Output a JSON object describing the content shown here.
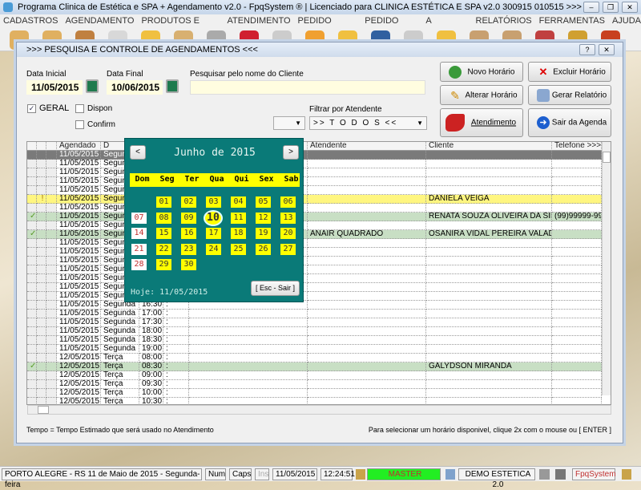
{
  "window": {
    "title": "Programa Clinica de Estética e SPA + Agendamento v2.0 - FpqSystem ® | Licenciado para  CLINICA ESTÉTICA E SPA v2.0 300915 010515 >>>"
  },
  "menu": [
    "CADASTROS",
    "AGENDAMENTO",
    "PRODUTOS E SERVIÇOS",
    "ATENDIMENTO",
    "PEDIDO COMPRAS",
    "PEDIDO VENDAS",
    "A RECEBER",
    "RELATÓRIOS",
    "FERRAMENTAS",
    "AJUDA"
  ],
  "dialog": {
    "title": ">>>  PESQUISA E CONTROLE DE AGENDAMENTOS  <<<",
    "help": "?",
    "close": "✕"
  },
  "filters": {
    "data_inicial_label": "Data Inicial",
    "data_inicial": "11/05/2015",
    "data_final_label": "Data Final",
    "data_final": "10/06/2015",
    "search_label": "Pesquisar pelo nome do Cliente",
    "search_value": "",
    "geral": "GERAL",
    "disponivel": "Dispon",
    "confirmado": "Confirm",
    "atendente_label": "Filtrar por Atendente",
    "atendente_value": ">> T O D O S <<"
  },
  "buttons": {
    "novo": "Novo Horário",
    "excluir": "Excluir Horário",
    "alterar": "Alterar Horário",
    "relatorio": "Gerar Relatório",
    "atendimento": "Atendimento",
    "sair": "Sair da Agenda"
  },
  "grid": {
    "headers": [
      "",
      "",
      "",
      "Agendado",
      "D",
      "",
      "",
      "",
      "Atendente",
      "Cliente",
      "Telefone  >>>"
    ],
    "rows": [
      [
        "",
        "",
        "",
        "11/05/2015",
        "Segunda",
        "08:00",
        ":",
        "",
        "",
        "",
        ""
      ],
      [
        "",
        "",
        "",
        "11/05/2015",
        "Segunda",
        "08:30",
        ":",
        "",
        "",
        "",
        ""
      ],
      [
        "",
        "",
        "",
        "11/05/2015",
        "Segunda",
        "09:00",
        ":",
        "",
        "",
        "",
        ""
      ],
      [
        "",
        "",
        "",
        "11/05/2015",
        "Segunda",
        "09:30",
        ":",
        "",
        "",
        "",
        ""
      ],
      [
        "",
        "",
        "",
        "11/05/2015",
        "Segunda",
        "10:00",
        ":",
        "",
        "",
        "",
        ""
      ],
      [
        "",
        "!",
        "",
        "11/05/2015",
        "Segunda",
        "10:30",
        ":",
        "",
        "",
        "DANIELA VEIGA",
        ""
      ],
      [
        "",
        "",
        "",
        "11/05/2015",
        "Segunda",
        "11:00",
        ":",
        "",
        "",
        "",
        ""
      ],
      [
        "✓",
        "",
        "",
        "11/05/2015",
        "Segunda",
        "11:30",
        ":",
        "",
        "",
        "RENATA SOUZA OLIVEIRA DA SILVA",
        "(99)99999-9999"
      ],
      [
        "",
        "",
        "",
        "11/05/2015",
        "Segunda",
        "12:00",
        ":",
        "",
        "",
        "",
        ""
      ],
      [
        "✓",
        "",
        "",
        "11/05/2015",
        "Segunda",
        "12:30",
        ":",
        "",
        "ANAIR QUADRADO",
        "OSANIRA VIDAL PEREIRA VALADARES",
        ""
      ],
      [
        "",
        "",
        "",
        "11/05/2015",
        "Segunda",
        "13:00",
        ":",
        "",
        "",
        "",
        ""
      ],
      [
        "",
        "",
        "",
        "11/05/2015",
        "Segunda",
        "13:30",
        ":",
        "",
        "",
        "",
        ""
      ],
      [
        "",
        "",
        "",
        "11/05/2015",
        "Segunda",
        "14:00",
        ":",
        "",
        "",
        "",
        ""
      ],
      [
        "",
        "",
        "",
        "11/05/2015",
        "Segunda",
        "14:30",
        ":",
        "",
        "",
        "",
        ""
      ],
      [
        "",
        "",
        "",
        "11/05/2015",
        "Segunda",
        "15:00",
        ":",
        "",
        "",
        "",
        ""
      ],
      [
        "",
        "",
        "",
        "11/05/2015",
        "Segunda",
        "15:30",
        ":",
        "",
        "",
        "",
        ""
      ],
      [
        "",
        "",
        "",
        "11/05/2015",
        "Segunda",
        "16:00",
        ":",
        "",
        "",
        "",
        ""
      ],
      [
        "",
        "",
        "",
        "11/05/2015",
        "Segunda",
        "16:30",
        ":",
        "",
        "",
        "",
        ""
      ],
      [
        "",
        "",
        "",
        "11/05/2015",
        "Segunda",
        "17:00",
        ":",
        "",
        "",
        "",
        ""
      ],
      [
        "",
        "",
        "",
        "11/05/2015",
        "Segunda",
        "17:30",
        ":",
        "",
        "",
        "",
        ""
      ],
      [
        "",
        "",
        "",
        "11/05/2015",
        "Segunda",
        "18:00",
        ":",
        "",
        "",
        "",
        ""
      ],
      [
        "",
        "",
        "",
        "11/05/2015",
        "Segunda",
        "18:30",
        ":",
        "",
        "",
        "",
        ""
      ],
      [
        "",
        "",
        "",
        "11/05/2015",
        "Segunda",
        "19:00",
        ":",
        "",
        "",
        "",
        ""
      ],
      [
        "",
        "",
        "",
        "12/05/2015",
        "Terça",
        "08:00",
        ":",
        "",
        "",
        "",
        ""
      ],
      [
        "✓",
        "",
        "",
        "12/05/2015",
        "Terça",
        "08:30",
        ":",
        "",
        "",
        "GALYDSON MIRANDA",
        ""
      ],
      [
        "",
        "",
        "",
        "12/05/2015",
        "Terça",
        "09:00",
        ":",
        "",
        "",
        "",
        ""
      ],
      [
        "",
        "",
        "",
        "12/05/2015",
        "Terça",
        "09:30",
        ":",
        "",
        "",
        "",
        ""
      ],
      [
        "",
        "",
        "",
        "12/05/2015",
        "Terça",
        "10:00",
        ":",
        "",
        "",
        "",
        ""
      ],
      [
        "",
        "",
        "",
        "12/05/2015",
        "Terça",
        "10:30",
        ":",
        "",
        "",
        "",
        ""
      ]
    ],
    "row_status": [
      "selected",
      "",
      "",
      "",
      "",
      "pending",
      "",
      "done",
      "",
      "done",
      "",
      "",
      "",
      "",
      "",
      "",
      "",
      "",
      "",
      "",
      "",
      "",
      "",
      "",
      "done",
      "",
      "",
      "",
      ""
    ],
    "colors": {
      "selected": "#7a7a7a",
      "pending": "#fff680",
      "done": "#c8dfc4"
    }
  },
  "calendar": {
    "title": "Junho de 2015",
    "prev": "<",
    "next": ">",
    "weekdays": [
      "Dom",
      "Seg",
      "Ter",
      "Qua",
      "Qui",
      "Sex",
      "Sab"
    ],
    "first_weekday": 1,
    "days": 30,
    "selected": 10,
    "today_label": "Hoje: 11/05/2015",
    "close": "[ Esc - Sair ]"
  },
  "footer": {
    "left": "Tempo = Tempo Estimado que será usado no Atendimento",
    "right": "Para selecionar um horário disponivel, clique 2x com o mouse ou [ ENTER ]"
  },
  "status": {
    "location": "PORTO ALEGRE - RS 11 de Maio de 2015 - Segunda-feira",
    "num": "Num",
    "caps": "Caps",
    "ins": "Ins",
    "date": "11/05/2015",
    "time": "12:24:51",
    "user": "MASTER",
    "db": "DEMO ESTETICA 2.0",
    "brand": "FpqSystem",
    "user_color": "#22ee22"
  }
}
